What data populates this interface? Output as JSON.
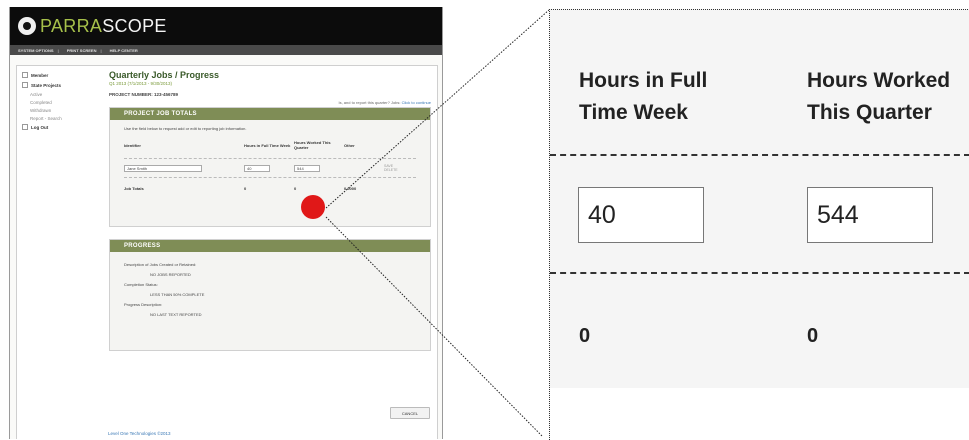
{
  "app": {
    "logo_prefix": "PARRA",
    "logo_suffix": "SCOPE",
    "nav": [
      "SYSTEM OPTIONS",
      "PRINT SCREEN",
      "HELP CENTER"
    ]
  },
  "sidebar": {
    "items": [
      {
        "label": "Member"
      },
      {
        "label": "State Projects"
      },
      {
        "label": "Active"
      },
      {
        "label": "Completed"
      },
      {
        "label": "Withdrawn"
      },
      {
        "label": "Report - Search"
      },
      {
        "label": "Log Out"
      }
    ]
  },
  "page": {
    "title": "Quarterly Jobs / Progress",
    "date_range": "Q1 2013 (7/1/2013 - 9/30/2013)",
    "project_number": "PROJECT NUMBER: 123-456789",
    "report_link_text": "Is, and to report this quarter? Jobs:",
    "report_link_action": "Click to continue"
  },
  "jobs_section": {
    "header": "PROJECT JOB TOTALS",
    "instructions": "Use the field below to request add or edit to reporting job information.",
    "col_headers": [
      "Identifier",
      "Hours in Full Time Week",
      "Hours Worked This Quarter",
      "Other"
    ],
    "row": {
      "name": "Jane Smith",
      "hours_full": "40",
      "hours_worked": "544",
      "save": "SAVE",
      "delete": "DELETE"
    },
    "totals_label": "Job Totals",
    "totals": [
      "0",
      "0"
    ],
    "totals_other": "0.0000"
  },
  "progress_section": {
    "header": "PROGRESS",
    "lines": [
      "Description of Jobs Created or Retained:",
      "NO JOBS REPORTED",
      "Completion Status:",
      "LESS THAN 50% COMPLETE",
      "Progress Description:",
      "NO LAST TEXT REPORTED"
    ]
  },
  "buttons": {
    "cancel": "CANCEL"
  },
  "footer": {
    "text": "Level One Technologies ©2013"
  },
  "zoom": {
    "col1_header_line1": "Hours in Full",
    "col1_header_line2": "Time Week",
    "col2_header_line1": "Hours Worked",
    "col2_header_line2": "This Quarter",
    "input1": "40",
    "input2": "544",
    "total1": "0",
    "total2": "0"
  },
  "colors": {
    "accent": "#7f8d56",
    "marker": "#e01818",
    "brand_green": "#a6c04a"
  }
}
